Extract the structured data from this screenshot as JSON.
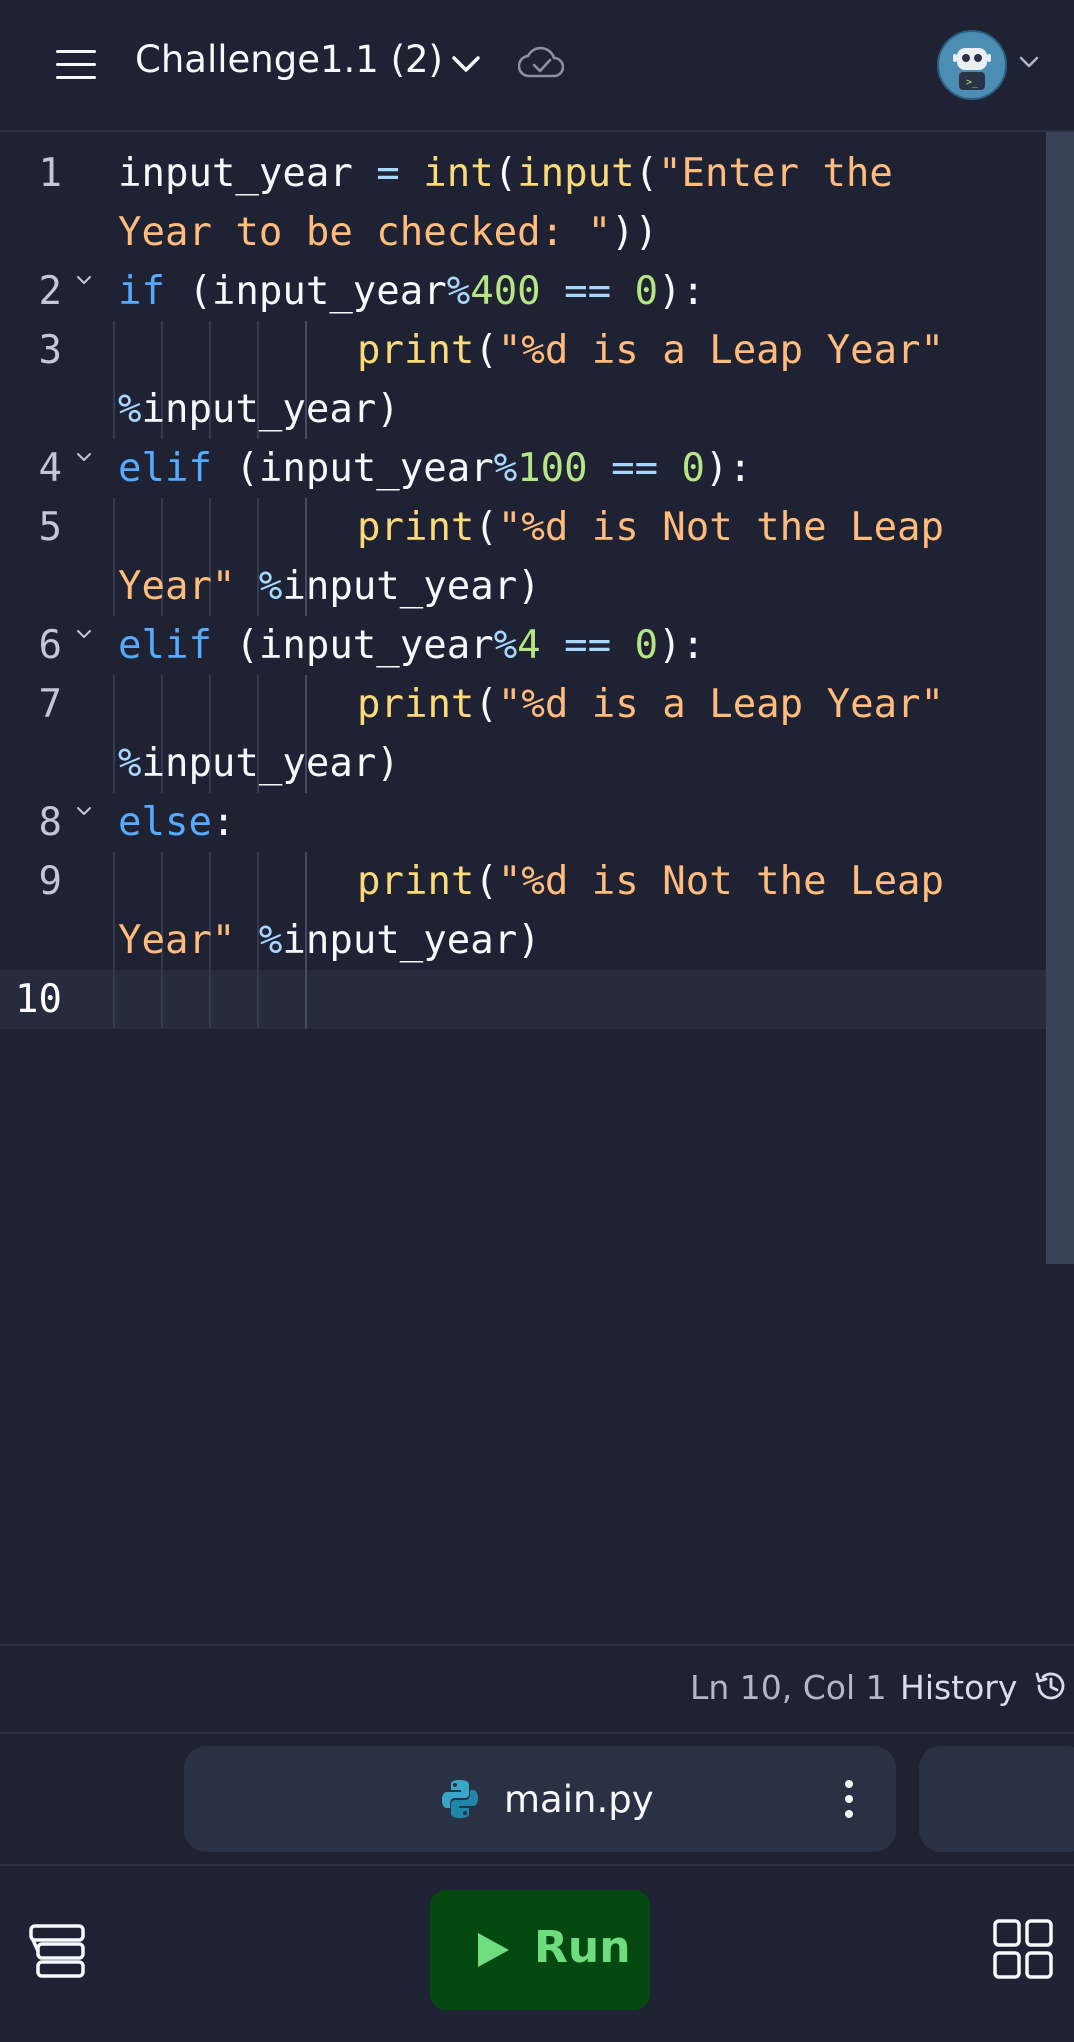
{
  "header": {
    "title": "Challenge1.1 (2)",
    "menu_icon": "hamburger-menu-icon",
    "dropdown_icon": "chevron-down-icon",
    "status_icon": "saved-check-icon",
    "avatar": "robot-avatar"
  },
  "editor": {
    "lines": [
      {
        "num": "1",
        "rows": [
          [
            {
              "t": "input_year ",
              "c": ""
            },
            {
              "t": "= ",
              "c": "op"
            },
            {
              "t": "int",
              "c": "fn"
            },
            {
              "t": "(",
              "c": ""
            },
            {
              "t": "input",
              "c": "fn"
            },
            {
              "t": "(",
              "c": ""
            },
            {
              "t": "\"Enter the",
              "c": "str"
            }
          ],
          [
            {
              "t": "Year to be checked: \"",
              "c": "str"
            },
            {
              "t": "))",
              "c": ""
            }
          ]
        ]
      },
      {
        "num": "2",
        "fold": true,
        "rows": [
          [
            {
              "t": "if",
              "c": "kw"
            },
            {
              "t": " (input_year",
              "c": ""
            },
            {
              "t": "%",
              "c": "op"
            },
            {
              "t": "400",
              "c": "num"
            },
            {
              "t": " == ",
              "c": "op"
            },
            {
              "t": "0",
              "c": "num"
            },
            {
              "t": "):",
              "c": ""
            }
          ]
        ]
      },
      {
        "num": "3",
        "indent": true,
        "rows": [
          [
            {
              "t": "print",
              "c": "fn"
            },
            {
              "t": "(",
              "c": ""
            },
            {
              "t": "\"%d is a Leap Year\"",
              "c": "str"
            }
          ],
          [
            {
              "t": "%",
              "c": "op"
            },
            {
              "t": "input_year)",
              "c": ""
            }
          ]
        ]
      },
      {
        "num": "4",
        "fold": true,
        "rows": [
          [
            {
              "t": "elif",
              "c": "kw"
            },
            {
              "t": " (input_year",
              "c": ""
            },
            {
              "t": "%",
              "c": "op"
            },
            {
              "t": "100",
              "c": "num"
            },
            {
              "t": " == ",
              "c": "op"
            },
            {
              "t": "0",
              "c": "num"
            },
            {
              "t": "):",
              "c": ""
            }
          ]
        ]
      },
      {
        "num": "5",
        "indent": true,
        "rows": [
          [
            {
              "t": "print",
              "c": "fn"
            },
            {
              "t": "(",
              "c": ""
            },
            {
              "t": "\"%d is Not the Leap",
              "c": "str"
            }
          ],
          [
            {
              "t": "Year\"",
              "c": "str"
            },
            {
              "t": " %",
              "c": "op"
            },
            {
              "t": "input_year)",
              "c": ""
            }
          ]
        ]
      },
      {
        "num": "6",
        "fold": true,
        "rows": [
          [
            {
              "t": "elif",
              "c": "kw"
            },
            {
              "t": " (input_year",
              "c": ""
            },
            {
              "t": "%",
              "c": "op"
            },
            {
              "t": "4",
              "c": "num"
            },
            {
              "t": " == ",
              "c": "op"
            },
            {
              "t": "0",
              "c": "num"
            },
            {
              "t": "):",
              "c": ""
            }
          ]
        ]
      },
      {
        "num": "7",
        "indent": true,
        "rows": [
          [
            {
              "t": "print",
              "c": "fn"
            },
            {
              "t": "(",
              "c": ""
            },
            {
              "t": "\"%d is a Leap Year\"",
              "c": "str"
            }
          ],
          [
            {
              "t": "%",
              "c": "op"
            },
            {
              "t": "input_year)",
              "c": ""
            }
          ]
        ]
      },
      {
        "num": "8",
        "fold": true,
        "rows": [
          [
            {
              "t": "else",
              "c": "kw"
            },
            {
              "t": ":",
              "c": ""
            }
          ]
        ]
      },
      {
        "num": "9",
        "indent": true,
        "rows": [
          [
            {
              "t": "print",
              "c": "fn"
            },
            {
              "t": "(",
              "c": ""
            },
            {
              "t": "\"%d is Not the Leap",
              "c": "str"
            }
          ],
          [
            {
              "t": "Year\"",
              "c": "str"
            },
            {
              "t": " %",
              "c": "op"
            },
            {
              "t": "input_year)",
              "c": ""
            }
          ]
        ]
      },
      {
        "num": "10",
        "active": true,
        "indent": true,
        "rows": [
          []
        ]
      }
    ]
  },
  "statusbar": {
    "cursor_position": "Ln 10, Col 1",
    "history_label": "History",
    "history_icon": "history-clock-icon"
  },
  "files": {
    "active_file": "main.py",
    "file_icon": "python-icon",
    "more_icon": "more-vertical-icon"
  },
  "toolbar": {
    "run_label": "Run",
    "run_icon": "play-icon",
    "left_icon": "layers-icon",
    "right_icon": "grid-icon"
  },
  "colors": {
    "background": "#1e2232",
    "keyword": "#57abff",
    "function": "#fbda7a",
    "string": "#ffbc7d",
    "number": "#b7e585",
    "operator": "#a7d6ff",
    "run_button": "#044a10",
    "run_text": "#6fdd7e"
  }
}
